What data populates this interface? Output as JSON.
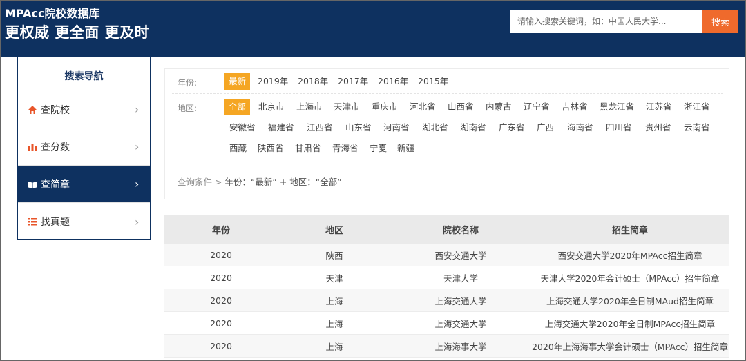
{
  "header": {
    "brand": "MPAcc院校数据库",
    "slogan": "更权威 更全面 更及时",
    "search_placeholder": "请输入搜索关键词，如：中国人民大学...",
    "search_button": "搜索"
  },
  "sidebar": {
    "title": "搜索导航",
    "items": [
      {
        "label": "查院校",
        "icon": "home-icon"
      },
      {
        "label": "查分数",
        "icon": "bar-chart-icon"
      },
      {
        "label": "查简章",
        "icon": "book-icon",
        "active": true
      },
      {
        "label": "找真题",
        "icon": "list-icon"
      }
    ]
  },
  "filter": {
    "year_label": "年份:",
    "years": [
      "最新",
      "2019年",
      "2018年",
      "2017年",
      "2016年",
      "2015年"
    ],
    "region_label": "地区:",
    "regions": [
      "全部",
      "北京市",
      "上海市",
      "天津市",
      "重庆市",
      "河北省",
      "山西省",
      "内蒙古",
      "辽宁省",
      "吉林省",
      "黑龙江省",
      "江苏省",
      "浙江省",
      "安徽省",
      "福建省",
      "江西省",
      "山东省",
      "河南省",
      "湖北省",
      "湖南省",
      "广东省",
      "广西",
      "海南省",
      "四川省",
      "贵州省",
      "云南省",
      "西藏",
      "陕西省",
      "甘肃省",
      "青海省",
      "宁夏",
      "新疆"
    ],
    "query_prefix": "查询条件 >",
    "query_text": "年份：“最新” + 地区：“全部”"
  },
  "table": {
    "headers": [
      "年份",
      "地区",
      "院校名称",
      "招生简章"
    ],
    "rows": [
      [
        "2020",
        "陕西",
        "西安交通大学",
        "西安交通大学2020年MPAcc招生简章"
      ],
      [
        "2020",
        "天津",
        "天津大学",
        "天津大学2020年会计硕士（MPAcc）招生简章"
      ],
      [
        "2020",
        "上海",
        "上海交通大学",
        "上海交通大学2020年全日制MAud招生简章"
      ],
      [
        "2020",
        "上海",
        "上海交通大学",
        "上海交通大学2020年全日制MPAcc招生简章"
      ],
      [
        "2020",
        "上海",
        "上海海事大学",
        "2020年上海海事大学会计硕士（MPAcc）招生简章"
      ]
    ]
  },
  "colors": {
    "navy": "#0e3160",
    "orange": "#ef6a2c",
    "tag_active": "#f5a623"
  }
}
